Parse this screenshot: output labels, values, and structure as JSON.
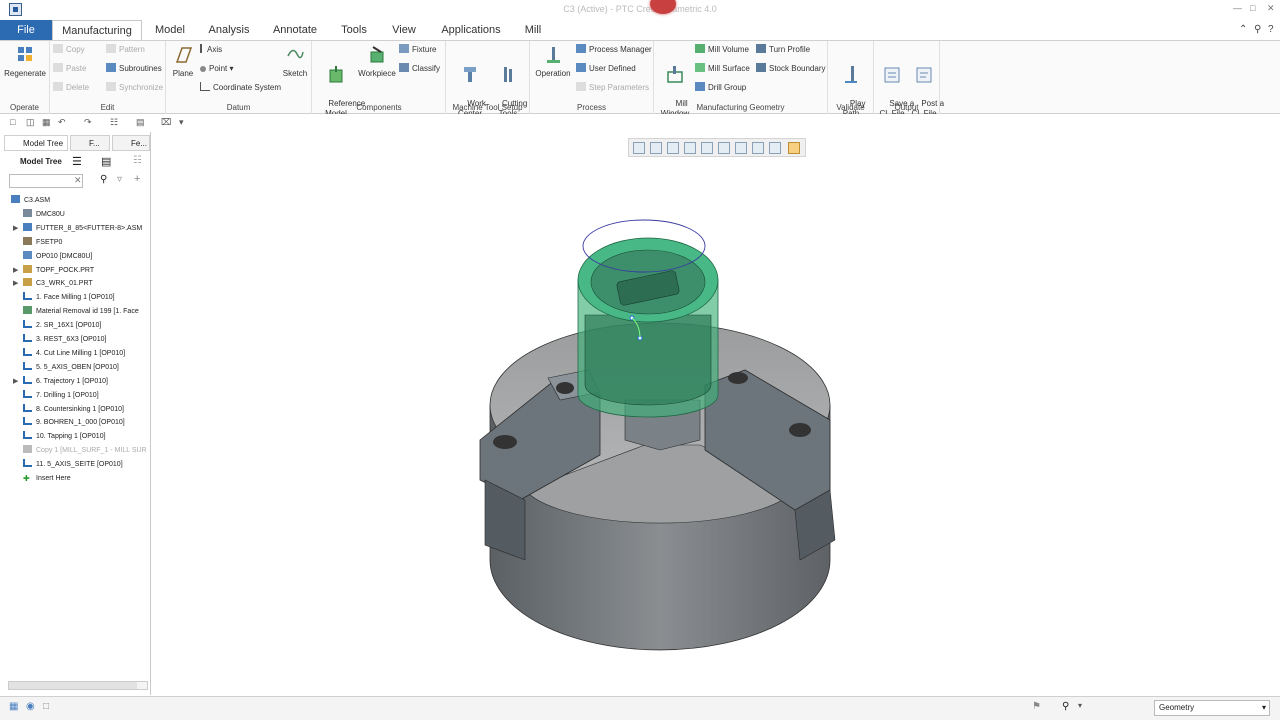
{
  "window": {
    "title": "C3 (Active) - PTC Creo Parametric 4.0"
  },
  "tabs": [
    "File",
    "Manufacturing",
    "Model",
    "Analysis",
    "Annotate",
    "Tools",
    "View",
    "Applications",
    "Mill"
  ],
  "ribbon": {
    "operate": {
      "label": "Operate",
      "regenerate": "Regenerate"
    },
    "edit": {
      "label": "Edit",
      "copy": "Copy",
      "paste": "Paste",
      "delete": "Delete",
      "pattern": "Pattern",
      "subroutines": "Subroutines",
      "synchronize": "Synchronize"
    },
    "datum": {
      "label": "Datum",
      "plane": "Plane",
      "axis": "Axis",
      "point": "Point",
      "coord": "Coordinate System",
      "sketch": "Sketch"
    },
    "components": {
      "label": "Components",
      "reference_model": "Reference\nModel",
      "workpiece": "Workpiece",
      "fixture": "Fixture",
      "classify": "Classify"
    },
    "machine": {
      "label": "Machine Tool Setup",
      "work_center": "Work\nCenter",
      "cutting_tools": "Cutting\nTools"
    },
    "process": {
      "label": "Process",
      "operation": "Operation",
      "process_manager": "Process Manager",
      "user_defined": "User Defined",
      "step_parameters": "Step Parameters"
    },
    "mfg_geom": {
      "label": "Manufacturing Geometry",
      "mill_window": "Mill\nWindow",
      "mill_volume": "Mill Volume",
      "mill_surface": "Mill Surface",
      "drill_group": "Drill Group",
      "turn_profile": "Turn Profile",
      "stock_boundary": "Stock Boundary"
    },
    "validate": {
      "label": "Validate",
      "play_path": "Play\nPath"
    },
    "output": {
      "label": "Output",
      "save_cl": "Save a\nCL File",
      "post_cl": "Post a\nCL File"
    }
  },
  "panel": {
    "tabs": [
      "Model Tree",
      "F...",
      "Fe..."
    ],
    "header": "Model Tree",
    "search_placeholder": ""
  },
  "tree": [
    {
      "label": "C3.ASM",
      "indent": 0,
      "icon": "assembly-icon",
      "exp": false
    },
    {
      "label": "DMC80U",
      "indent": 1,
      "icon": "machine-icon",
      "exp": false
    },
    {
      "label": "FUTTER_8_85<FUTTER-8>.ASM",
      "indent": 1,
      "icon": "assembly-icon",
      "exp": true
    },
    {
      "label": "FSETP0",
      "indent": 1,
      "icon": "setup-icon",
      "exp": false
    },
    {
      "label": "OP010 [DMC80U]",
      "indent": 1,
      "icon": "operation-icon",
      "exp": false
    },
    {
      "label": "TOPF_POCK.PRT",
      "indent": 1,
      "icon": "part-icon",
      "exp": true
    },
    {
      "label": "C3_WRK_01.PRT",
      "indent": 1,
      "icon": "part-icon",
      "exp": true
    },
    {
      "label": "1. Face Milling 1 [OP010]",
      "indent": 1,
      "icon": "toolpath-icon",
      "exp": false
    },
    {
      "label": "Material Removal id 199 [1. Face",
      "indent": 1,
      "icon": "material-removal-icon",
      "exp": false
    },
    {
      "label": "2. SR_16X1 [OP010]",
      "indent": 1,
      "icon": "toolpath-icon",
      "exp": false
    },
    {
      "label": "3. REST_6X3 [OP010]",
      "indent": 1,
      "icon": "toolpath-icon",
      "exp": false
    },
    {
      "label": "4. Cut Line Milling 1 [OP010]",
      "indent": 1,
      "icon": "toolpath-icon",
      "exp": false
    },
    {
      "label": "5. 5_AXIS_OBEN [OP010]",
      "indent": 1,
      "icon": "toolpath-icon",
      "exp": false
    },
    {
      "label": "6. Trajectory 1 [OP010]",
      "indent": 1,
      "icon": "toolpath-icon",
      "exp": true
    },
    {
      "label": "7. Drilling 1 [OP010]",
      "indent": 1,
      "icon": "toolpath-icon",
      "exp": false
    },
    {
      "label": "8. Countersinking 1 [OP010]",
      "indent": 1,
      "icon": "toolpath-icon",
      "exp": false
    },
    {
      "label": "9. BOHREN_1_000 [OP010]",
      "indent": 1,
      "icon": "toolpath-icon",
      "exp": false
    },
    {
      "label": "10. Tapping 1 [OP010]",
      "indent": 1,
      "icon": "toolpath-icon",
      "exp": false
    },
    {
      "label": "Copy 1 [MILL_SURF_1 - MILL SUR",
      "indent": 1,
      "icon": "copy-icon",
      "exp": false,
      "grey": true
    },
    {
      "label": "11. 5_AXIS_SEITE [OP010]",
      "indent": 1,
      "icon": "toolpath-icon",
      "exp": false
    },
    {
      "label": "Insert Here",
      "indent": 1,
      "icon": "insert-icon",
      "exp": false
    }
  ],
  "status": {
    "filter": "Geometry"
  },
  "colors": {
    "accent": "#2c6ab1",
    "model_grey": "#6d7276",
    "workpiece": "#3fb07a"
  }
}
